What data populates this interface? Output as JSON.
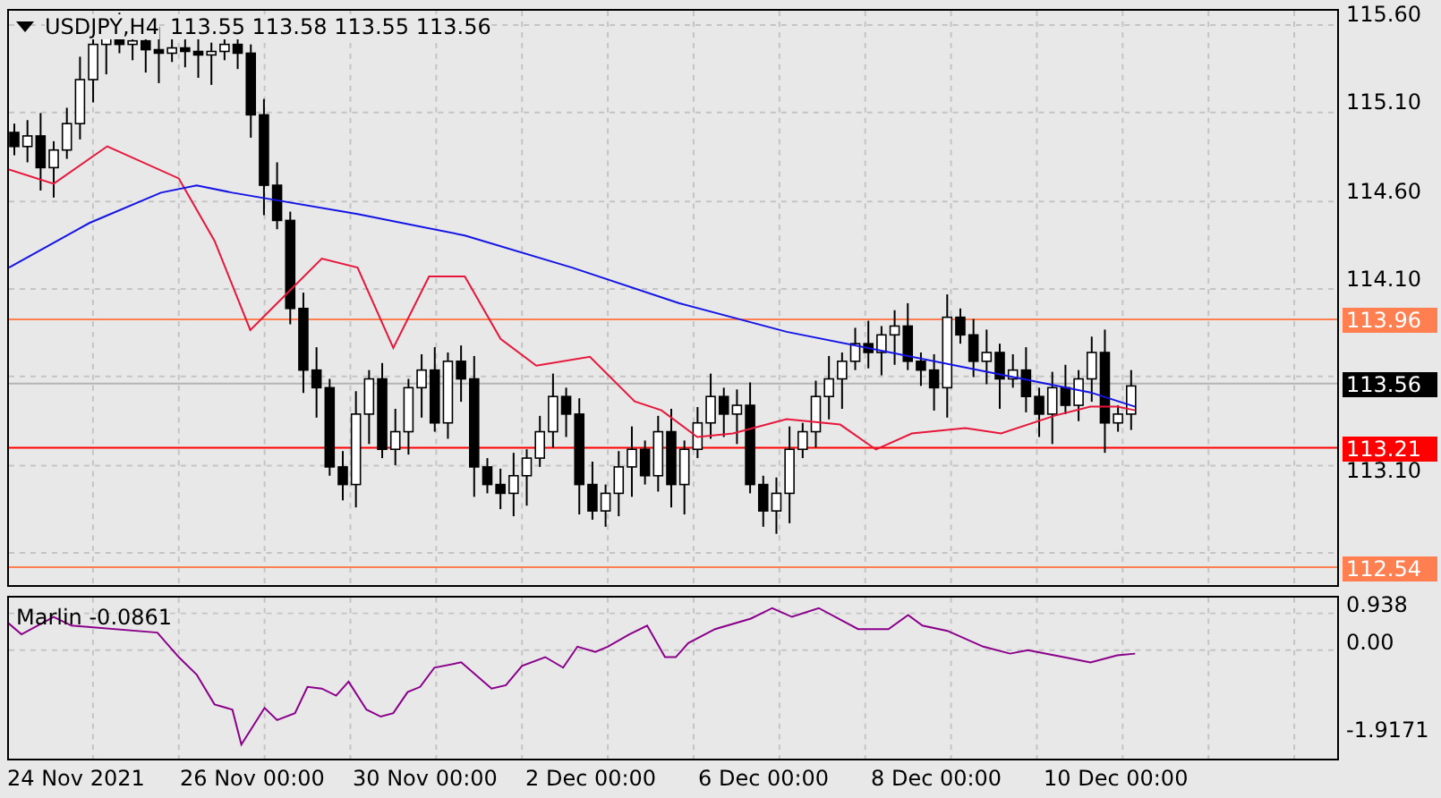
{
  "header": {
    "symbol": "USDJPY,H4",
    "ohlc": "113.55 113.58 113.55 113.56"
  },
  "price_axis": {
    "ticks": [
      "115.60",
      "115.10",
      "114.60",
      "114.10",
      "113.10"
    ]
  },
  "price_labels": [
    {
      "label": "113.96",
      "color": "#ff7f50"
    },
    {
      "label": "113.56",
      "color": "#000000"
    },
    {
      "label": "113.21",
      "color": "#ff0000"
    },
    {
      "label": "112.54",
      "color": "#ff7f50"
    }
  ],
  "indicator": {
    "label": "Marlin -0.0861",
    "ticks": [
      "0.938",
      "0.00",
      "-1.9171"
    ]
  },
  "time_axis": {
    "labels": [
      "24 Nov 2021",
      "26 Nov 00:00",
      "30 Nov 00:00",
      "2 Dec 00:00",
      "6 Dec 00:00",
      "8 Dec 00:00",
      "10 Dec 00:00"
    ]
  }
}
